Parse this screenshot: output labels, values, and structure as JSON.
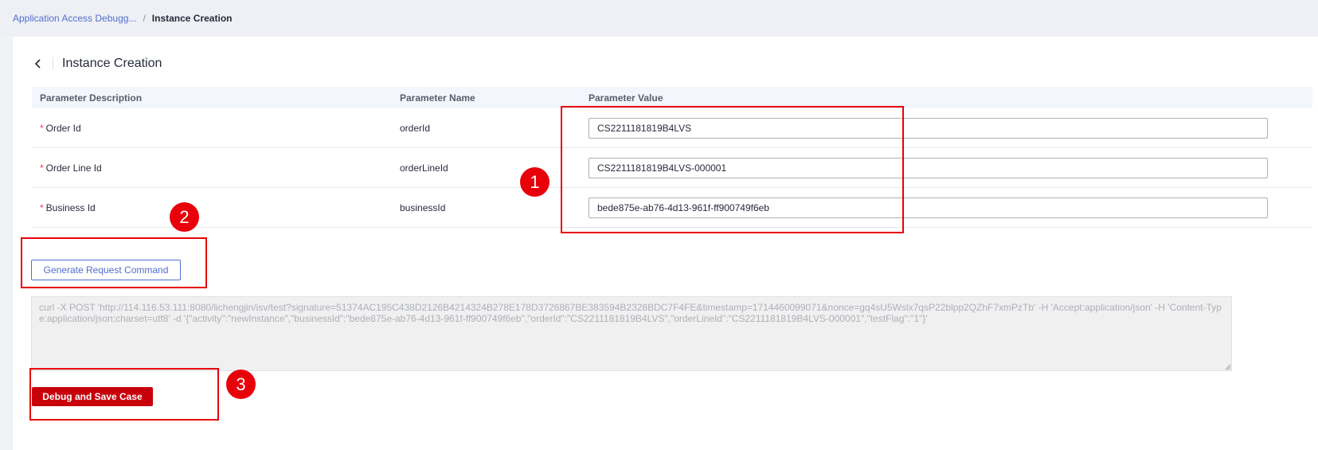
{
  "breadcrumb": {
    "parent": "Application Access Debugg...",
    "separator": "/",
    "current": "Instance Creation"
  },
  "page": {
    "title": "Instance Creation",
    "back_icon": "chevron-left-icon"
  },
  "table": {
    "headers": {
      "description": "Parameter Description",
      "name": "Parameter Name",
      "value": "Parameter Value"
    },
    "rows": [
      {
        "required_mark": "*",
        "description": "Order Id",
        "name": "orderId",
        "value": "CS2211181819B4LVS"
      },
      {
        "required_mark": "*",
        "description": "Order Line Id",
        "name": "orderLineId",
        "value": "CS2211181819B4LVS-000001"
      },
      {
        "required_mark": "*",
        "description": "Business Id",
        "name": "businessId",
        "value": "bede875e-ab76-4d13-961f-ff900749f6eb"
      }
    ]
  },
  "actions": {
    "generate_label": "Generate Request Command",
    "debug_label": "Debug and Save Case"
  },
  "command": {
    "text": "curl -X POST 'http://114.116.53.111:8080/lichengjin/isv/test?signature=51374AC195C438D2126B4214324B278E178D3726867BE383594B2328BDC7F4FE&timestamp=1714460099071&nonce=gq4sU5Wslx7qsP22blpp2QZhF7xmPzTb' -H 'Accept:application/json' -H 'Content-Type:application/json;charset=utf8' -d '{\"activity\":\"newInstance\",\"businessId\":\"bede875e-ab76-4d13-961f-ff900749f6eb\",\"orderId\":\"CS2211181819B4LVS\",\"orderLineId\":\"CS2211181819B4LVS-000001\",\"testFlag\":\"1\"}'"
  },
  "annotations": {
    "badge1": "1",
    "badge2": "2",
    "badge3": "3"
  },
  "colors": {
    "accent": "#526ecc",
    "primary_button": "#c7000b",
    "annotation": "#e8000b",
    "required": "#e54545"
  }
}
